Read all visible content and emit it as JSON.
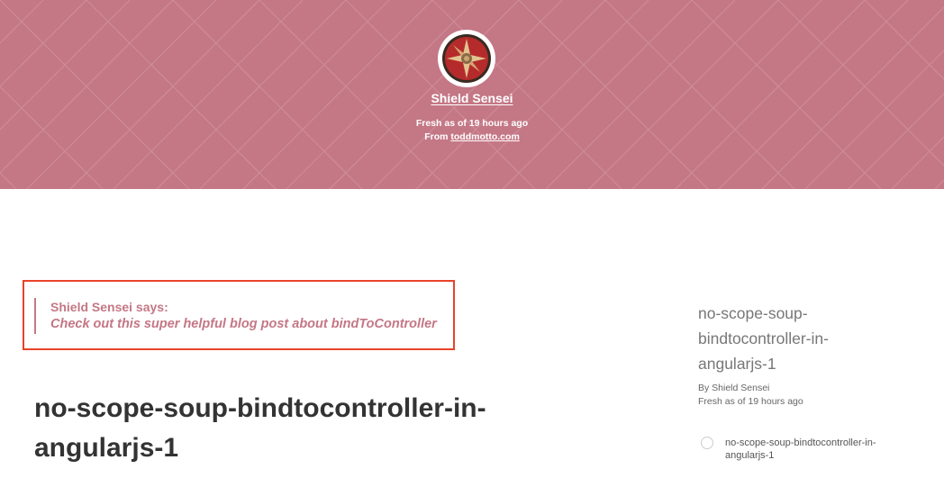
{
  "header": {
    "author_name": "Shield Sensei",
    "fresh_text": "Fresh as of 19 hours ago",
    "from_prefix": "From ",
    "from_link": "toddmotto.com",
    "background_color": "#c47785",
    "avatar_icon": "shield-avatar-icon"
  },
  "callout": {
    "title": "Shield Sensei says:",
    "body": "Check out this super helpful blog post about bindToController",
    "accent_color": "#c47785",
    "highlight_border_color": "#e8432a"
  },
  "post": {
    "title": "no-scope-soup-bindtocontroller-in-angularjs-1"
  },
  "sidebar": {
    "title": "no-scope-soup-bindtocontroller-in-angularjs-1",
    "by_line": "By Shield Sensei",
    "fresh_line": "Fresh as of 19 hours ago",
    "items": [
      {
        "label": "no-scope-soup-bindtocontroller-in-angularjs-1"
      }
    ]
  }
}
